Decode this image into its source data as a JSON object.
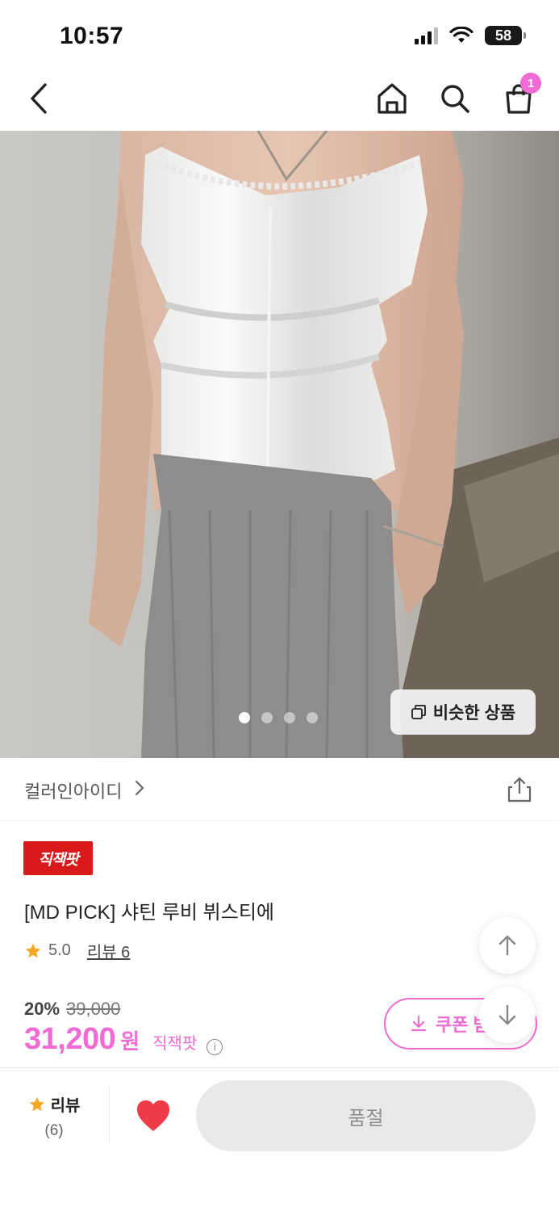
{
  "status_bar": {
    "time": "10:57",
    "battery": "58",
    "battery_level_pct": 58
  },
  "nav": {
    "cart_count": "1"
  },
  "carousel": {
    "total": 4,
    "active_index": 0,
    "similar_label": "비슷한 상품"
  },
  "brand": {
    "name": "컬러인아이디"
  },
  "product": {
    "badge": "직잭팟",
    "title": "[MD PICK] 샤틴 루비 뷔스티에",
    "rating": "5.0",
    "review_link": "리뷰 6",
    "discount": "20%",
    "original_price": "39,000",
    "sale_price": "31,200",
    "currency": "원",
    "zigzag_label": "직잭팟"
  },
  "coupon": {
    "label": "쿠폰 받"
  },
  "bottom_bar": {
    "review_label": "리뷰",
    "review_count": "(6)",
    "buy_label": "품절"
  },
  "colors": {
    "accent": "#f06bd3",
    "badge_red": "#d81a1a",
    "heart": "#ee3b47",
    "star": "#f5a623"
  }
}
